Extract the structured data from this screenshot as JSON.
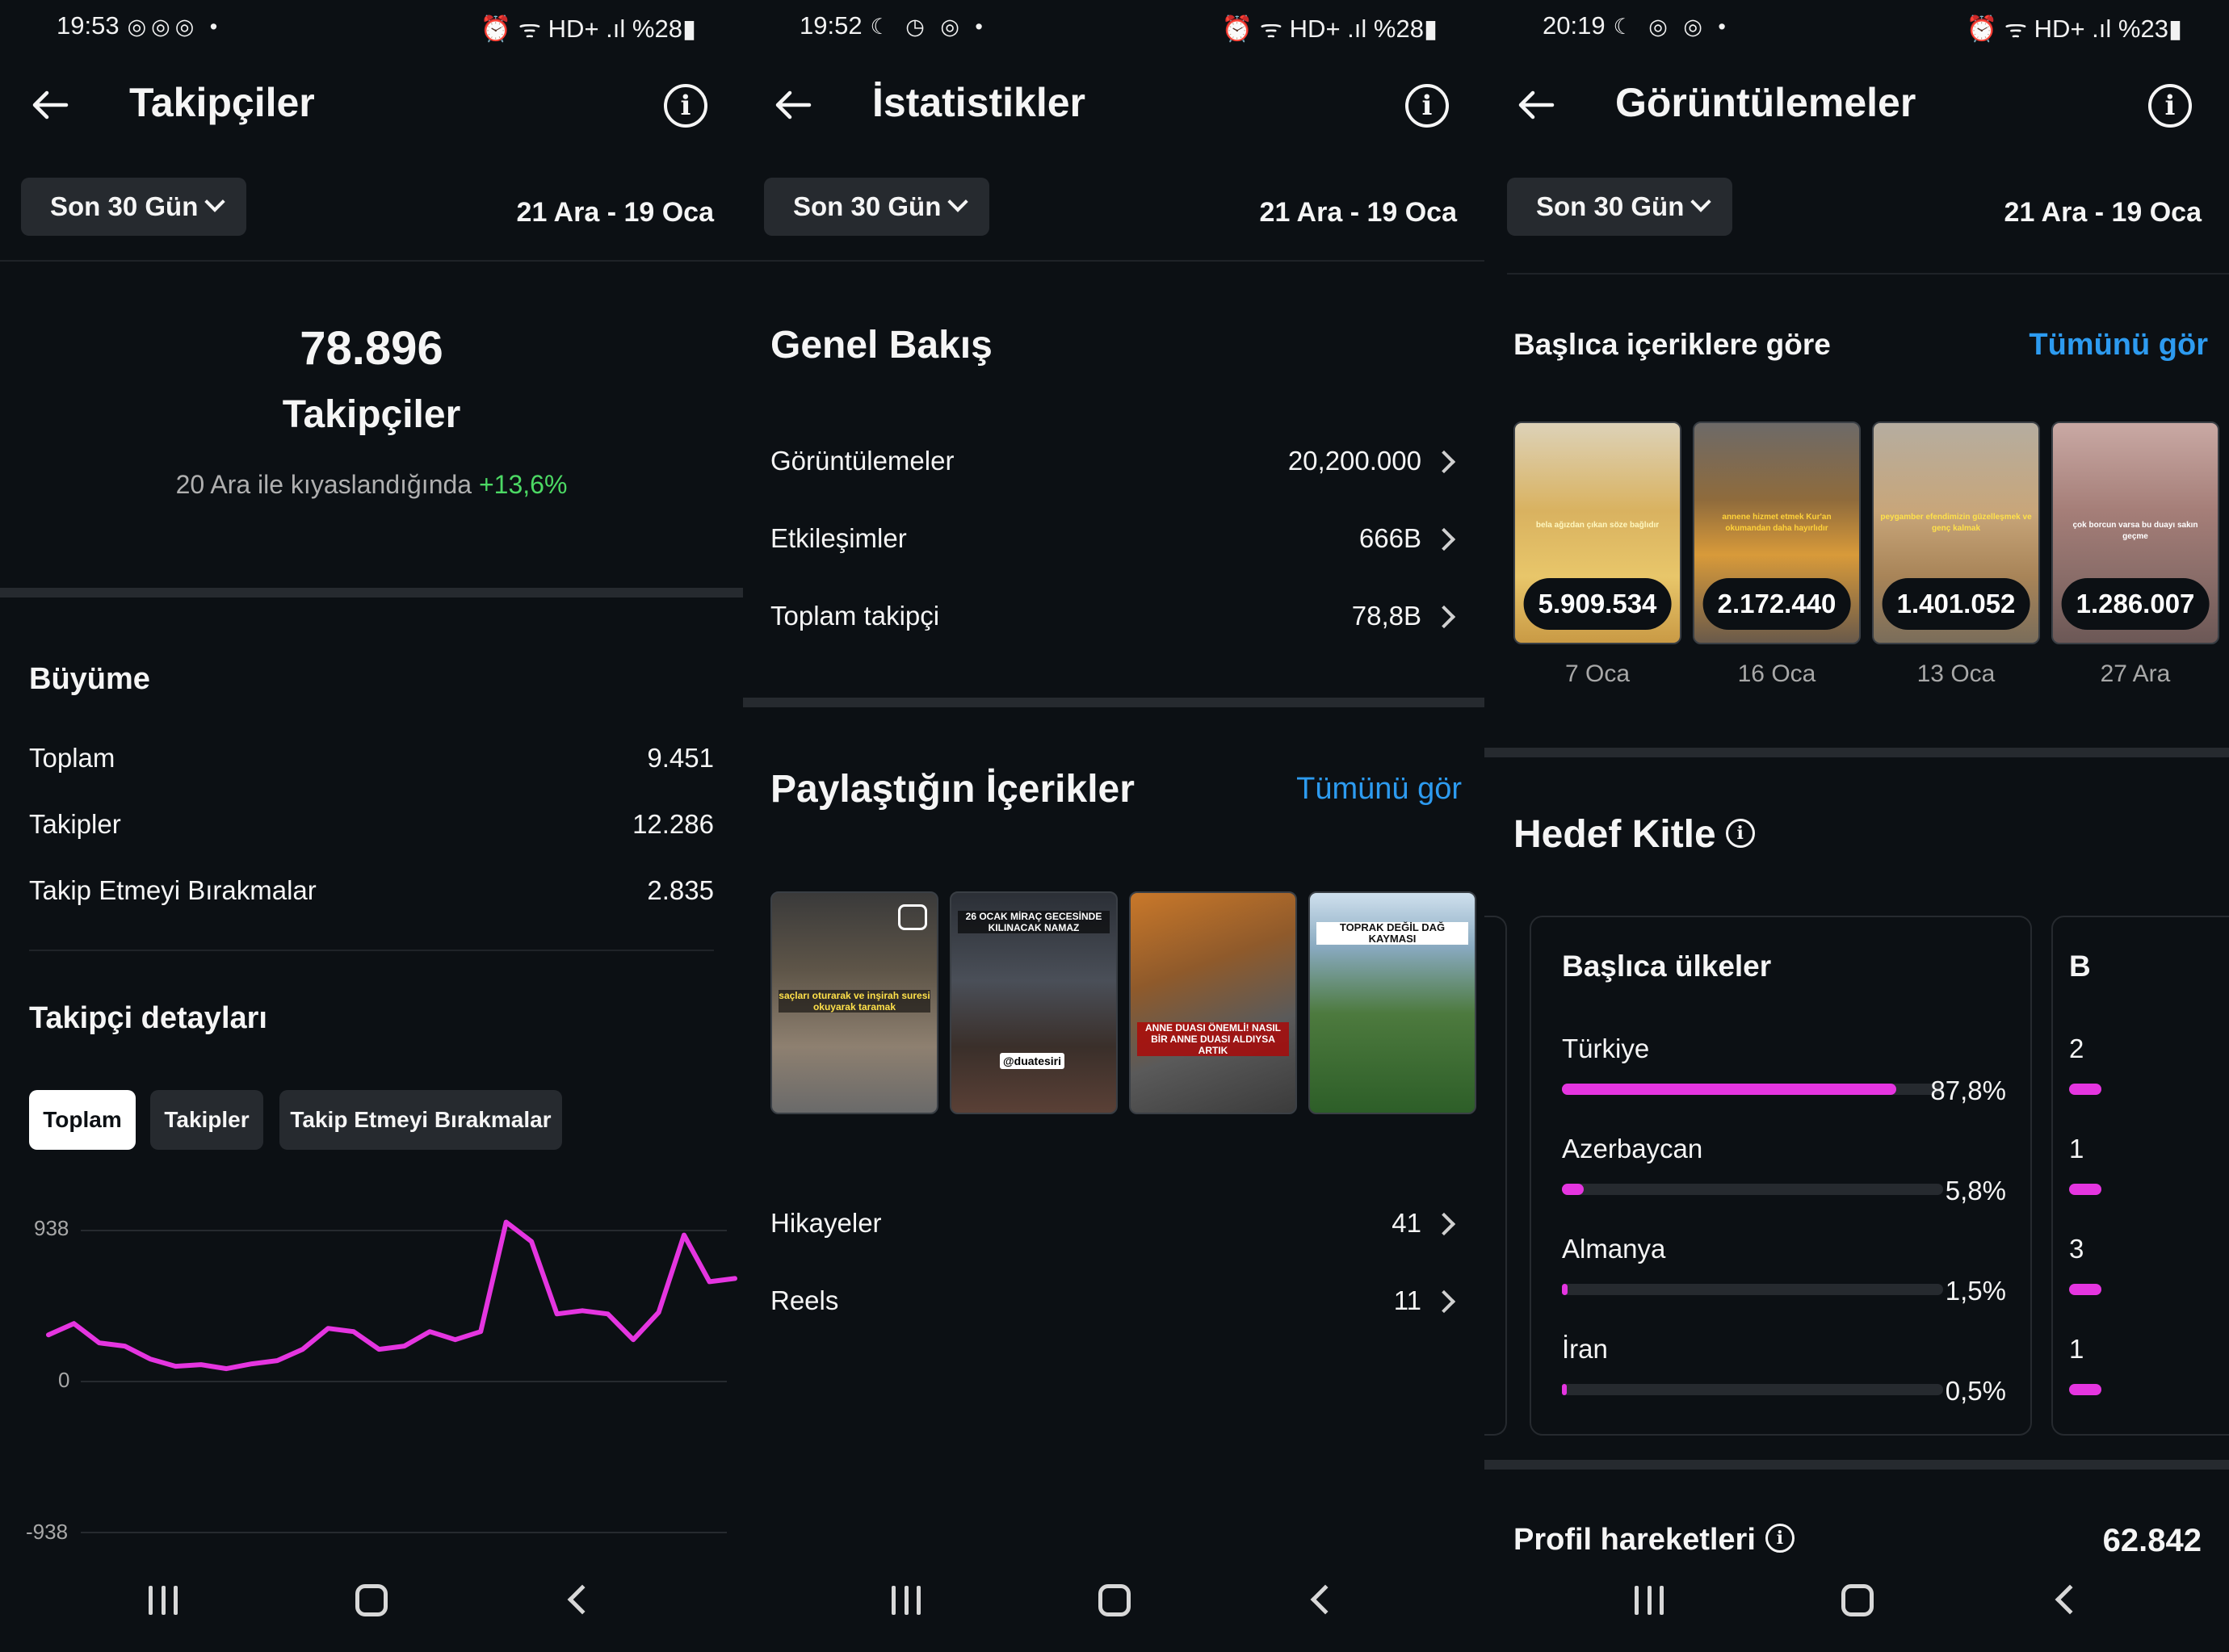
{
  "panels": [
    {
      "status": {
        "time": "19:53",
        "icons": "◎◎◎ •",
        "right": "⏰ ᯤ HD+ .ıl %28▮"
      },
      "title": "Takipçiler",
      "period_label": "Son 30 Gün",
      "date_range": "21 Ara - 19 Oca",
      "summary": {
        "value": "78.896",
        "label": "Takipçiler",
        "comparison_text": "20 Ara ile kıyaslandığında",
        "comparison_delta": "+13,6%"
      },
      "growth": {
        "title": "Büyüme",
        "rows": [
          {
            "label": "Toplam",
            "value": "9.451"
          },
          {
            "label": "Takipler",
            "value": "12.286"
          },
          {
            "label": "Takip Etmeyi Bırakmalar",
            "value": "2.835"
          }
        ]
      },
      "details": {
        "title": "Takipçi detayları",
        "tabs": [
          "Toplam",
          "Takipler",
          "Takip Etmeyi Bırakmalar"
        ],
        "active_tab": "Toplam"
      },
      "chart_data": {
        "type": "line",
        "series": [
          {
            "values": [
              290,
              360,
              240,
              220,
              140,
              95,
              105,
              80,
              110,
              130,
              200,
              330,
              310,
              200,
              220,
              310,
              260,
              310,
              990,
              870,
              420,
              440,
              420,
              260,
              430,
              910,
              620,
              640
            ]
          }
        ],
        "y_ticks": [
          "938",
          "0",
          "-938"
        ],
        "ylim": [
          -938,
          938
        ],
        "color": "#e535e0"
      }
    },
    {
      "status": {
        "time": "19:52",
        "icons": "☾ ◷ ◎ •",
        "right": "⏰ ᯤ HD+ .ıl %28▮"
      },
      "title": "İstatistikler",
      "period_label": "Son 30 Gün",
      "date_range": "21 Ara - 19 Oca",
      "overview": {
        "title": "Genel Bakış",
        "rows": [
          {
            "label": "Görüntülemeler",
            "value": "20,200.000"
          },
          {
            "label": "Etkileşimler",
            "value": "666B"
          },
          {
            "label": "Toplam takipçi",
            "value": "78,8B"
          }
        ]
      },
      "shared": {
        "title": "Paylaştığın İçerikler",
        "see_all": "Tümünü gör",
        "thumbs": [
          {
            "caption": "saçları oturarak ve inşirah suresi okuyarak taramak"
          },
          {
            "caption": "26 OCAK MİRAÇ GECESİNDE KILINACAK NAMAZ",
            "handle": "@duatesiri"
          },
          {
            "caption": "ANNE DUASI ÖNEMLİ! NASIL BİR ANNE DUASI ALDIYSA ARTIK"
          },
          {
            "caption": "TOPRAK DEĞİL DAĞ KAYMASI"
          }
        ],
        "rows": [
          {
            "label": "Hikayeler",
            "value": "41"
          },
          {
            "label": "Reels",
            "value": "11"
          }
        ]
      }
    },
    {
      "status": {
        "time": "20:19",
        "icons": "☾ ◎ ◎ •",
        "right": "⏰ ᯤ HD+ .ıl %23▮"
      },
      "title": "Görüntülemeler",
      "period_label": "Son 30 Gün",
      "date_range": "21 Ara - 19 Oca",
      "top_content": {
        "title": "Başlıca içeriklere göre",
        "see_all": "Tümünü gör",
        "items": [
          {
            "views": "5.909.534",
            "date": "7 Oca",
            "caption": "bela ağızdan çıkan söze bağlıdır"
          },
          {
            "views": "2.172.440",
            "date": "16 Oca",
            "caption": "annene hizmet etmek Kur'an okumandan daha hayırlıdır"
          },
          {
            "views": "1.401.052",
            "date": "13 Oca",
            "caption": "peygamber efendimizin güzelleşmek ve genç kalmak"
          },
          {
            "views": "1.286.007",
            "date": "27 Ara",
            "caption": "çok borcun varsa bu duayı sakın geçme"
          }
        ]
      },
      "audience": {
        "title": "Hedef Kitle",
        "countries_title": "Başlıca ülkeler",
        "countries": [
          {
            "name": "Türkiye",
            "percent": "87,8%",
            "fraction": 0.878
          },
          {
            "name": "Azerbaycan",
            "percent": "5,8%",
            "fraction": 0.058
          },
          {
            "name": "Almanya",
            "percent": "1,5%",
            "fraction": 0.015
          },
          {
            "name": "İran",
            "percent": "0,5%",
            "fraction": 0.005
          }
        ],
        "next_card_letters": [
          "B",
          "2",
          "1",
          "3",
          "1"
        ]
      },
      "profile_actions": {
        "label": "Profil hareketleri",
        "value": "62.842"
      }
    }
  ]
}
